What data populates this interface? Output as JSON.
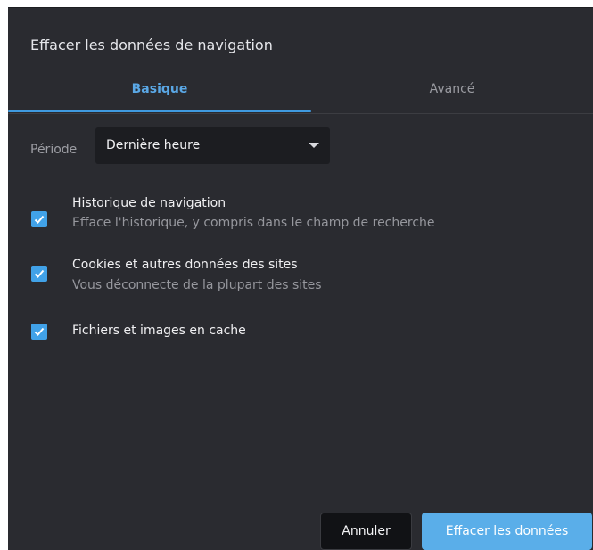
{
  "dialog": {
    "title": "Effacer les données de navigation"
  },
  "tabs": [
    {
      "label": "Basique",
      "active": true
    },
    {
      "label": "Avancé",
      "active": false
    }
  ],
  "period": {
    "label": "Période",
    "value": "Dernière heure"
  },
  "options": [
    {
      "title": "Historique de navigation",
      "subtitle": "Efface l'historique, y compris dans le champ de recherche",
      "checked": true
    },
    {
      "title": "Cookies et autres données des sites",
      "subtitle": "Vous déconnecte de la plupart des sites",
      "checked": true
    },
    {
      "title": "Fichiers et images en cache",
      "subtitle": "",
      "checked": true
    }
  ],
  "buttons": {
    "cancel": "Annuler",
    "confirm": "Effacer les données"
  },
  "colors": {
    "accent": "#41a2e8",
    "background": "#2a2b30"
  },
  "icons": {
    "dropdown": "chevron-down-icon",
    "checkbox": "check-icon"
  }
}
